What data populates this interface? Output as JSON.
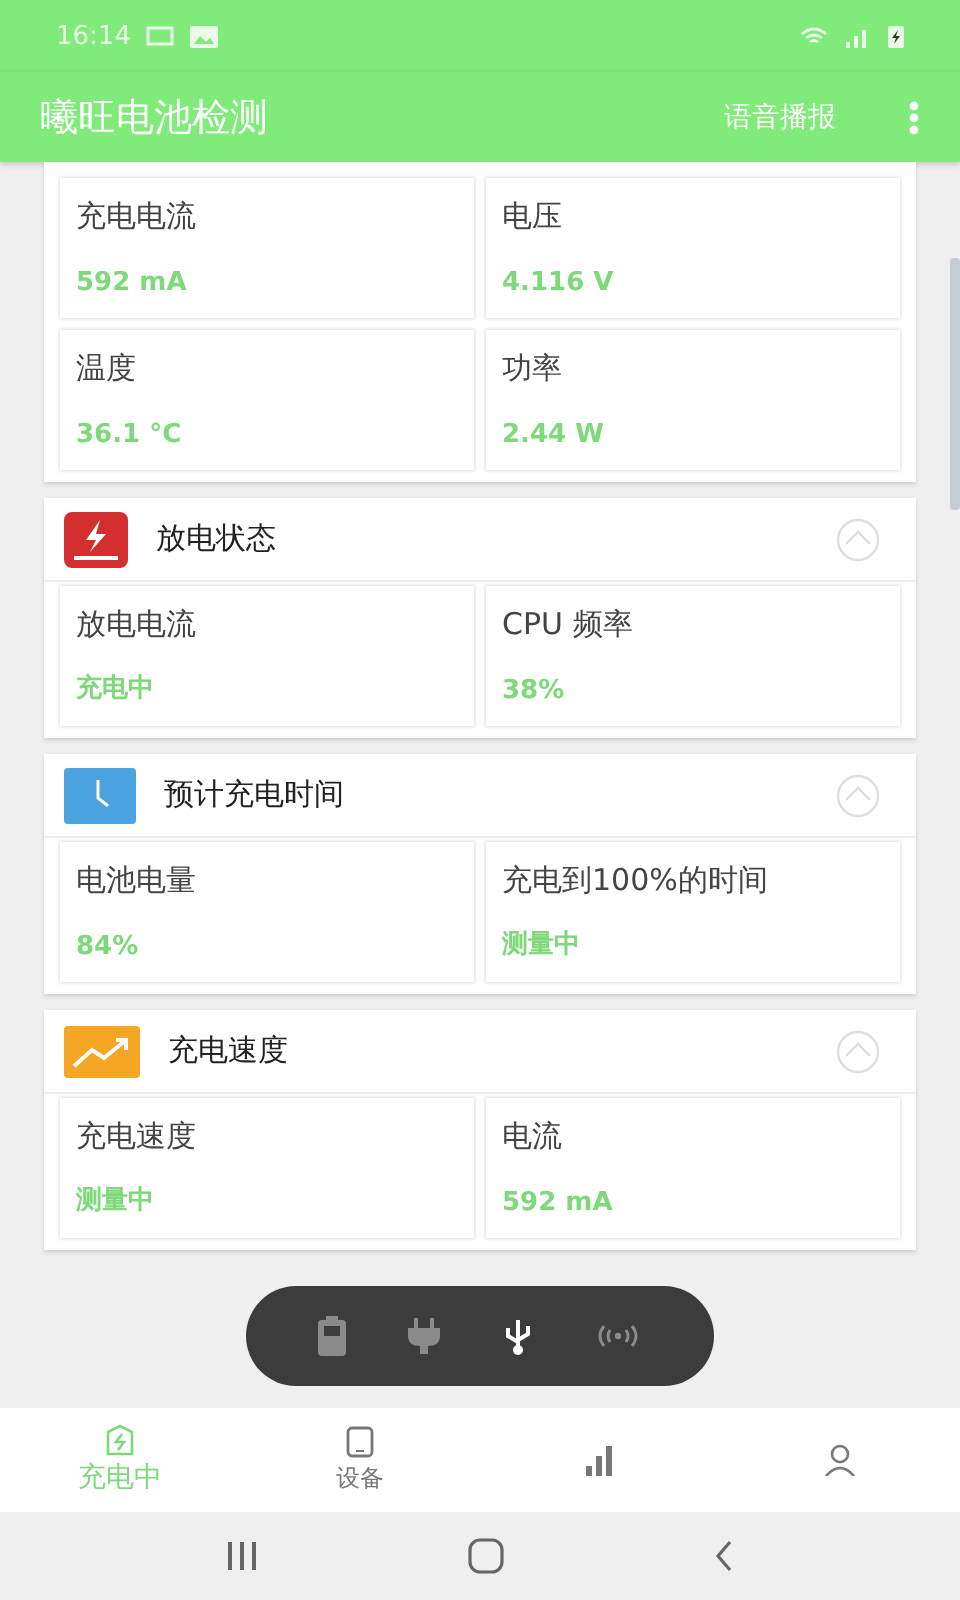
{
  "status_bar": {
    "time": "16:14"
  },
  "app_bar": {
    "title": "曦旺电池检测",
    "action": "语音播报"
  },
  "top_card": {
    "cells": [
      {
        "label": "充电电流",
        "value": "592 mA"
      },
      {
        "label": "电压",
        "value": "4.116 V"
      },
      {
        "label": "温度",
        "value": "36.1 °C"
      },
      {
        "label": "功率",
        "value": "2.44 W"
      }
    ]
  },
  "sections": [
    {
      "kind": "discharge",
      "title": "放电状态",
      "expanded": true,
      "cells": [
        {
          "label": "放电电流",
          "value": "充电中"
        },
        {
          "label": "CPU 频率",
          "value": "38%"
        }
      ]
    },
    {
      "kind": "time",
      "title": "预计充电时间",
      "expanded": true,
      "cells": [
        {
          "label": "电池电量",
          "value": "84%"
        },
        {
          "label": "充电到100%的时间",
          "value": "测量中"
        }
      ]
    },
    {
      "kind": "speed",
      "title": "充电速度",
      "expanded": true,
      "cells": [
        {
          "label": "充电速度",
          "value": "测量中"
        },
        {
          "label": "电流",
          "value": "592 mA"
        }
      ]
    }
  ],
  "sources": [
    {
      "kind": "battery",
      "selected": false
    },
    {
      "kind": "plug",
      "selected": false
    },
    {
      "kind": "usb",
      "selected": true
    },
    {
      "kind": "wireless",
      "selected": false
    }
  ],
  "tabs": [
    {
      "kind": "charging",
      "label": "充电中",
      "selected": true
    },
    {
      "kind": "device",
      "label": "设备",
      "selected": false
    },
    {
      "kind": "chart",
      "selected": false
    },
    {
      "kind": "person",
      "selected": false
    }
  ]
}
